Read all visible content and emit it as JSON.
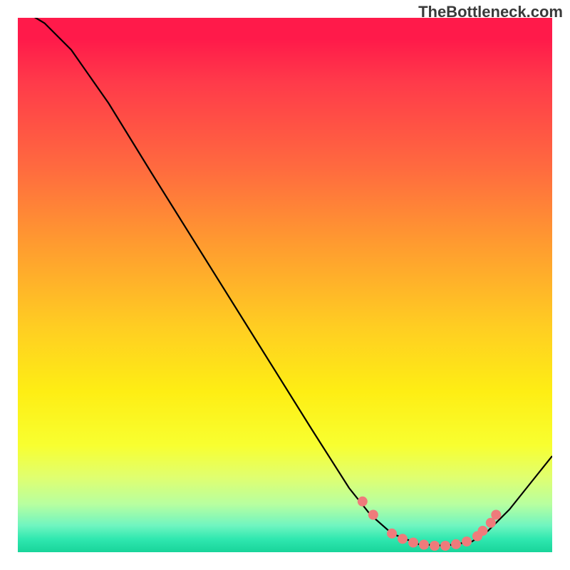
{
  "attribution": "TheBottleneck.com",
  "chart_data": {
    "type": "line",
    "title": "",
    "xlabel": "",
    "ylabel": "",
    "xlim": [
      0,
      100
    ],
    "ylim": [
      0,
      100
    ],
    "grid": false,
    "legend": false,
    "series": [
      {
        "name": "curve",
        "points": [
          {
            "x": 0.0,
            "y": 102.0
          },
          {
            "x": 5.0,
            "y": 99.0
          },
          {
            "x": 10.0,
            "y": 94.0
          },
          {
            "x": 17.0,
            "y": 84.0
          },
          {
            "x": 25.0,
            "y": 71.0
          },
          {
            "x": 35.0,
            "y": 55.0
          },
          {
            "x": 45.0,
            "y": 39.0
          },
          {
            "x": 55.0,
            "y": 23.0
          },
          {
            "x": 62.0,
            "y": 12.0
          },
          {
            "x": 66.0,
            "y": 7.0
          },
          {
            "x": 70.0,
            "y": 3.5
          },
          {
            "x": 75.0,
            "y": 1.5
          },
          {
            "x": 80.0,
            "y": 1.2
          },
          {
            "x": 85.0,
            "y": 2.0
          },
          {
            "x": 88.0,
            "y": 4.0
          },
          {
            "x": 92.0,
            "y": 8.0
          },
          {
            "x": 96.0,
            "y": 13.0
          },
          {
            "x": 100.0,
            "y": 18.0
          }
        ]
      }
    ],
    "markers": [
      {
        "x": 64.5,
        "y": 9.5
      },
      {
        "x": 66.5,
        "y": 7.0
      },
      {
        "x": 70.0,
        "y": 3.5
      },
      {
        "x": 72.0,
        "y": 2.5
      },
      {
        "x": 74.0,
        "y": 1.8
      },
      {
        "x": 76.0,
        "y": 1.4
      },
      {
        "x": 78.0,
        "y": 1.2
      },
      {
        "x": 80.0,
        "y": 1.2
      },
      {
        "x": 82.0,
        "y": 1.5
      },
      {
        "x": 84.0,
        "y": 2.0
      },
      {
        "x": 86.0,
        "y": 3.0
      },
      {
        "x": 87.0,
        "y": 4.0
      },
      {
        "x": 88.5,
        "y": 5.5
      },
      {
        "x": 89.5,
        "y": 7.0
      }
    ]
  }
}
